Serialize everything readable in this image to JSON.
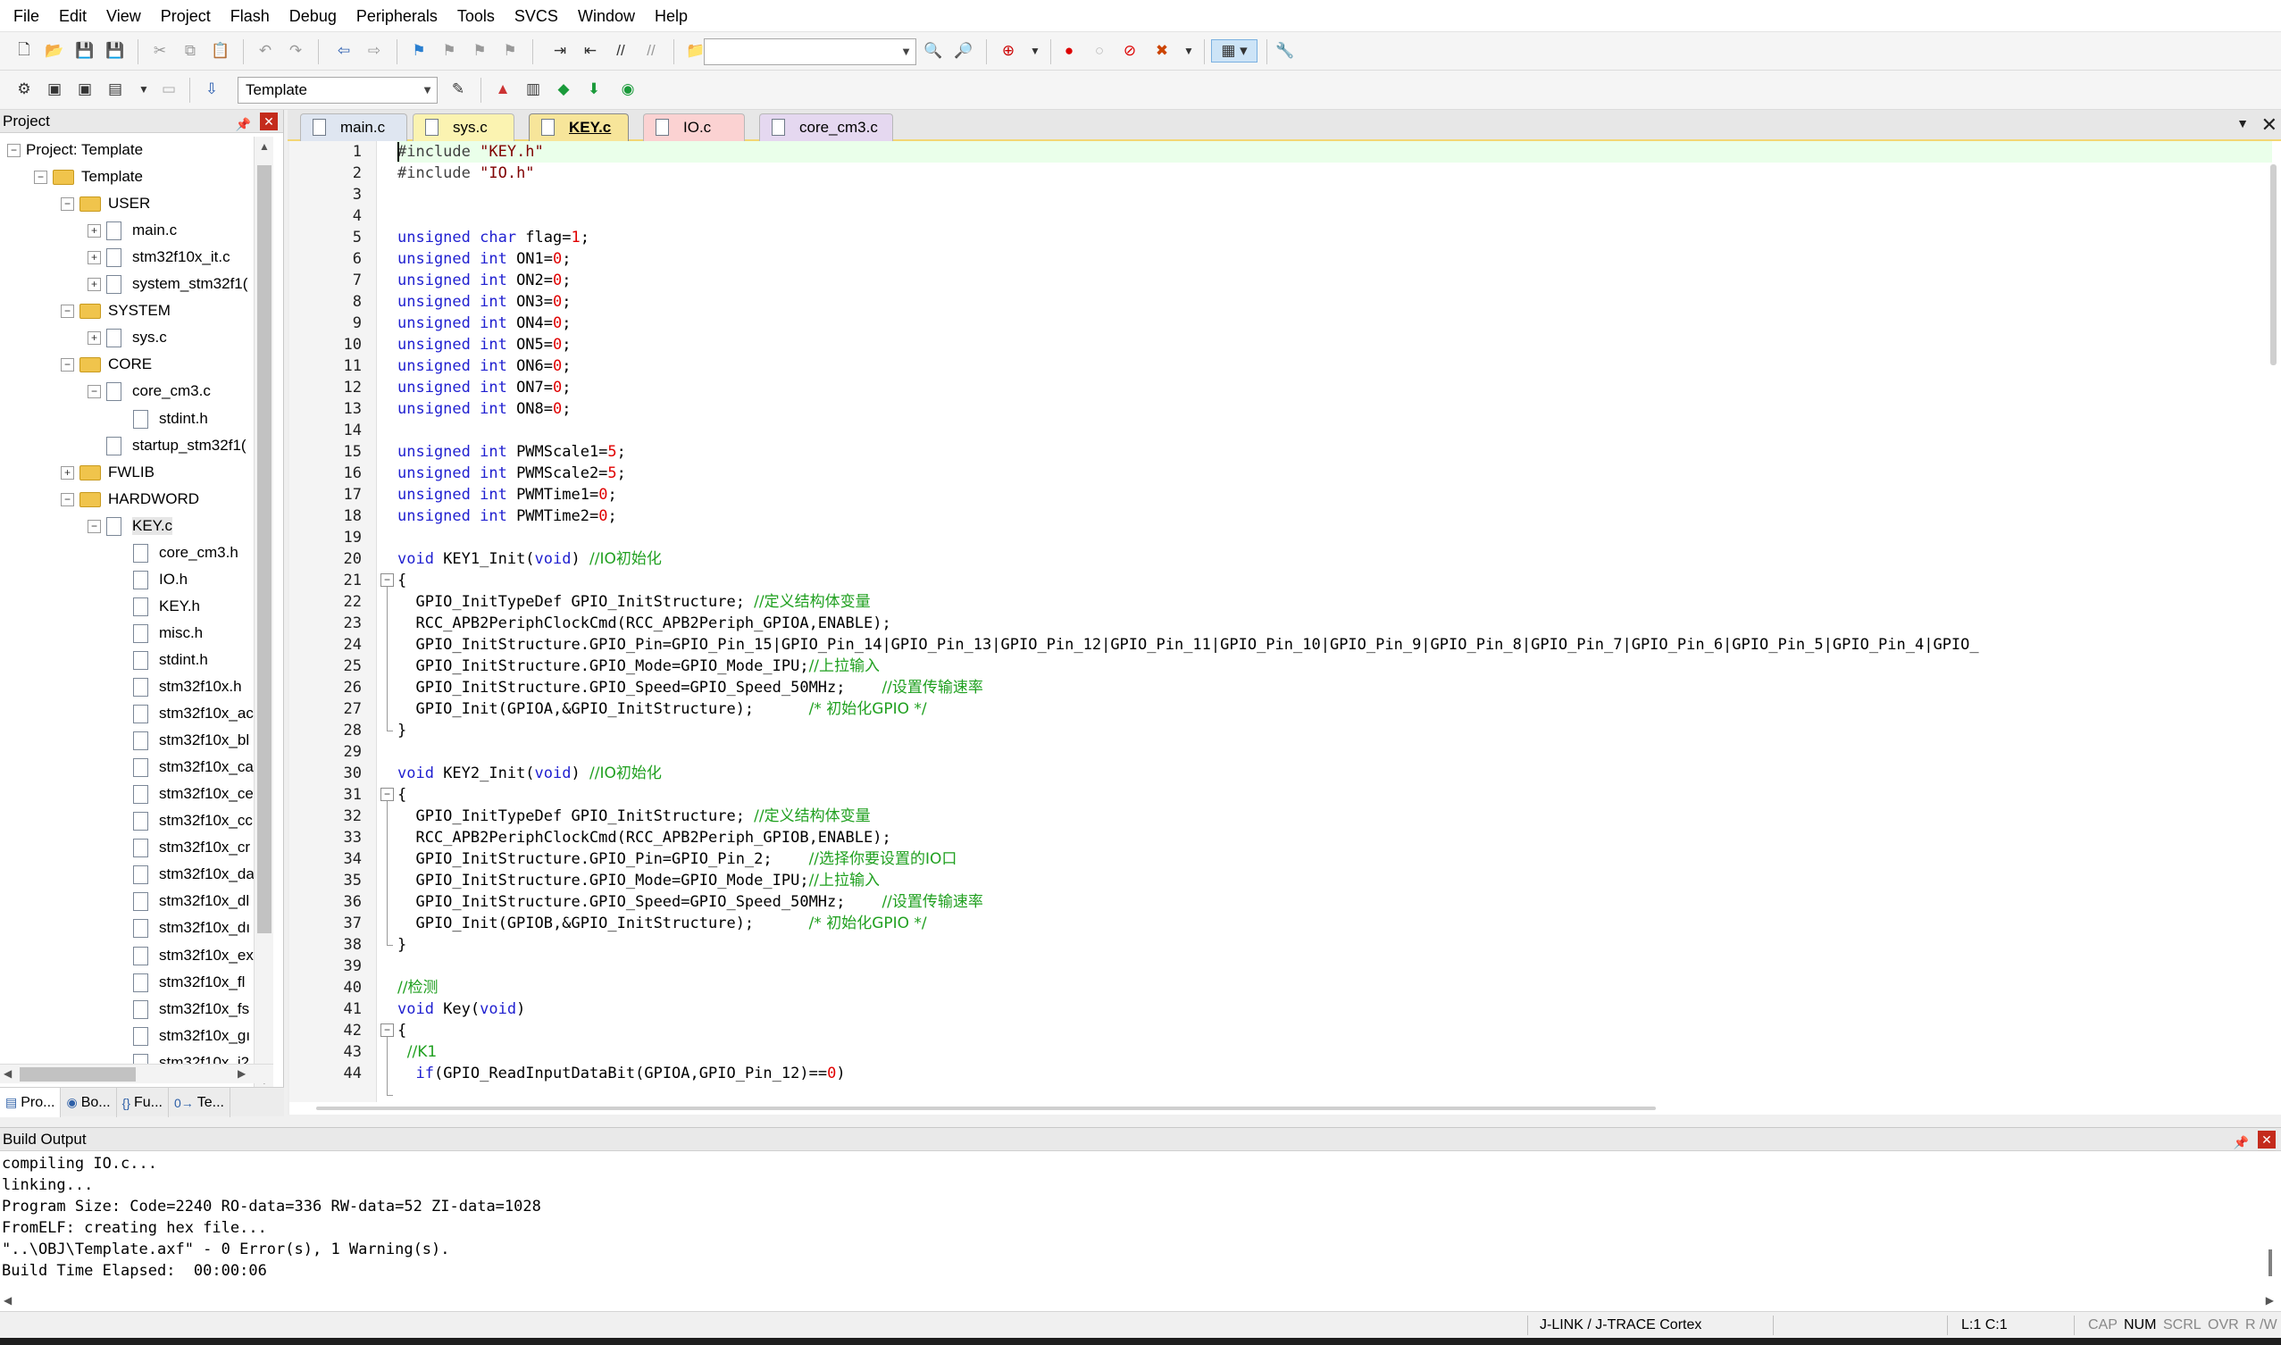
{
  "menu": [
    "File",
    "Edit",
    "View",
    "Project",
    "Flash",
    "Debug",
    "Peripherals",
    "Tools",
    "SVCS",
    "Window",
    "Help"
  ],
  "toolbar2": {
    "target_label": "Template"
  },
  "project_panel": {
    "title": "Project",
    "tree": [
      {
        "label": "Project: Template",
        "indent": 0,
        "expander": "-",
        "icon": "none"
      },
      {
        "label": "Template",
        "indent": 1,
        "expander": "-",
        "icon": "folder"
      },
      {
        "label": "USER",
        "indent": 2,
        "expander": "-",
        "icon": "folder"
      },
      {
        "label": "main.c",
        "indent": 3,
        "expander": "+",
        "icon": "file"
      },
      {
        "label": "stm32f10x_it.c",
        "indent": 3,
        "expander": "+",
        "icon": "file"
      },
      {
        "label": "system_stm32f1(",
        "indent": 3,
        "expander": "+",
        "icon": "file"
      },
      {
        "label": "SYSTEM",
        "indent": 2,
        "expander": "-",
        "icon": "folder"
      },
      {
        "label": "sys.c",
        "indent": 3,
        "expander": "+",
        "icon": "file"
      },
      {
        "label": "CORE",
        "indent": 2,
        "expander": "-",
        "icon": "folder"
      },
      {
        "label": "core_cm3.c",
        "indent": 3,
        "expander": "-",
        "icon": "file"
      },
      {
        "label": "stdint.h",
        "indent": 4,
        "expander": "",
        "icon": "file"
      },
      {
        "label": "startup_stm32f1(",
        "indent": 3,
        "expander": "",
        "icon": "file"
      },
      {
        "label": "FWLIB",
        "indent": 2,
        "expander": "+",
        "icon": "folder"
      },
      {
        "label": "HARDWORD",
        "indent": 2,
        "expander": "-",
        "icon": "folder"
      },
      {
        "label": "KEY.c",
        "indent": 3,
        "expander": "-",
        "icon": "file",
        "selected": true
      },
      {
        "label": "core_cm3.h",
        "indent": 4,
        "expander": "",
        "icon": "file"
      },
      {
        "label": "IO.h",
        "indent": 4,
        "expander": "",
        "icon": "file"
      },
      {
        "label": "KEY.h",
        "indent": 4,
        "expander": "",
        "icon": "file"
      },
      {
        "label": "misc.h",
        "indent": 4,
        "expander": "",
        "icon": "file"
      },
      {
        "label": "stdint.h",
        "indent": 4,
        "expander": "",
        "icon": "file"
      },
      {
        "label": "stm32f10x.h",
        "indent": 4,
        "expander": "",
        "icon": "file"
      },
      {
        "label": "stm32f10x_ac",
        "indent": 4,
        "expander": "",
        "icon": "file"
      },
      {
        "label": "stm32f10x_bl",
        "indent": 4,
        "expander": "",
        "icon": "file"
      },
      {
        "label": "stm32f10x_ca",
        "indent": 4,
        "expander": "",
        "icon": "file"
      },
      {
        "label": "stm32f10x_ce",
        "indent": 4,
        "expander": "",
        "icon": "file"
      },
      {
        "label": "stm32f10x_cc",
        "indent": 4,
        "expander": "",
        "icon": "file"
      },
      {
        "label": "stm32f10x_cr",
        "indent": 4,
        "expander": "",
        "icon": "file"
      },
      {
        "label": "stm32f10x_da",
        "indent": 4,
        "expander": "",
        "icon": "file"
      },
      {
        "label": "stm32f10x_dl",
        "indent": 4,
        "expander": "",
        "icon": "file"
      },
      {
        "label": "stm32f10x_dı",
        "indent": 4,
        "expander": "",
        "icon": "file"
      },
      {
        "label": "stm32f10x_ex",
        "indent": 4,
        "expander": "",
        "icon": "file"
      },
      {
        "label": "stm32f10x_fl",
        "indent": 4,
        "expander": "",
        "icon": "file"
      },
      {
        "label": "stm32f10x_fs",
        "indent": 4,
        "expander": "",
        "icon": "file"
      },
      {
        "label": "stm32f10x_gı",
        "indent": 4,
        "expander": "",
        "icon": "file"
      },
      {
        "label": "stm32f10x_i2",
        "indent": 4,
        "expander": "",
        "icon": "file"
      }
    ],
    "tabs": [
      {
        "label": "Pro...",
        "icon": "project-tab-icon",
        "glyph": "▤"
      },
      {
        "label": "Bo...",
        "icon": "books-tab-icon",
        "glyph": "◉"
      },
      {
        "label": "Fu...",
        "icon": "functions-tab-icon",
        "glyph": "{}"
      },
      {
        "label": "Te...",
        "icon": "templates-tab-icon",
        "glyph": "0→"
      }
    ]
  },
  "editor_tabs": [
    {
      "label": "main.c",
      "color": "#dfe6f1",
      "active": false
    },
    {
      "label": "sys.c",
      "color": "#fbf3b1",
      "active": false
    },
    {
      "label": "KEY.c",
      "color": "#f7e59a",
      "active": true
    },
    {
      "label": "IO.c",
      "color": "#fbd2d2",
      "active": false
    },
    {
      "label": "core_cm3.c",
      "color": "#e5d8f0",
      "active": false
    }
  ],
  "code_lines": [
    [
      [
        "pp",
        "#include "
      ],
      [
        "str",
        "\"KEY.h\""
      ]
    ],
    [
      [
        "pp",
        "#include "
      ],
      [
        "str",
        "\"IO.h\""
      ]
    ],
    [],
    [],
    [
      [
        "kw",
        "unsigned char "
      ],
      [
        "",
        "flag="
      ],
      [
        "num",
        "1"
      ],
      [
        "",
        ";"
      ]
    ],
    [
      [
        "kw",
        "unsigned int "
      ],
      [
        "",
        "ON1="
      ],
      [
        "num",
        "0"
      ],
      [
        "",
        ";"
      ]
    ],
    [
      [
        "kw",
        "unsigned int "
      ],
      [
        "",
        "ON2="
      ],
      [
        "num",
        "0"
      ],
      [
        "",
        ";"
      ]
    ],
    [
      [
        "kw",
        "unsigned int "
      ],
      [
        "",
        "ON3="
      ],
      [
        "num",
        "0"
      ],
      [
        "",
        ";"
      ]
    ],
    [
      [
        "kw",
        "unsigned int "
      ],
      [
        "",
        "ON4="
      ],
      [
        "num",
        "0"
      ],
      [
        "",
        ";"
      ]
    ],
    [
      [
        "kw",
        "unsigned int "
      ],
      [
        "",
        "ON5="
      ],
      [
        "num",
        "0"
      ],
      [
        "",
        ";"
      ]
    ],
    [
      [
        "kw",
        "unsigned int "
      ],
      [
        "",
        "ON6="
      ],
      [
        "num",
        "0"
      ],
      [
        "",
        ";"
      ]
    ],
    [
      [
        "kw",
        "unsigned int "
      ],
      [
        "",
        "ON7="
      ],
      [
        "num",
        "0"
      ],
      [
        "",
        ";"
      ]
    ],
    [
      [
        "kw",
        "unsigned int "
      ],
      [
        "",
        "ON8="
      ],
      [
        "num",
        "0"
      ],
      [
        "",
        ";"
      ]
    ],
    [],
    [
      [
        "kw",
        "unsigned int "
      ],
      [
        "",
        "PWMScale1="
      ],
      [
        "num",
        "5"
      ],
      [
        "",
        ";"
      ]
    ],
    [
      [
        "kw",
        "unsigned int "
      ],
      [
        "",
        "PWMScale2="
      ],
      [
        "num",
        "5"
      ],
      [
        "",
        ";"
      ]
    ],
    [
      [
        "kw",
        "unsigned int "
      ],
      [
        "",
        "PWMTime1="
      ],
      [
        "num",
        "0"
      ],
      [
        "",
        ";"
      ]
    ],
    [
      [
        "kw",
        "unsigned int "
      ],
      [
        "",
        "PWMTime2="
      ],
      [
        "num",
        "0"
      ],
      [
        "",
        ";"
      ]
    ],
    [],
    [
      [
        "kw",
        "void "
      ],
      [
        "",
        "KEY1_Init("
      ],
      [
        "kw",
        "void"
      ],
      [
        "",
        ") "
      ],
      [
        "cm",
        "//IO初始化"
      ]
    ],
    [
      [
        "",
        "{"
      ]
    ],
    [
      [
        "",
        "  GPIO_InitTypeDef GPIO_InitStructure; "
      ],
      [
        "cm",
        "//定义结构体变量"
      ]
    ],
    [
      [
        "",
        "  RCC_APB2PeriphClockCmd(RCC_APB2Periph_GPIOA,ENABLE);"
      ]
    ],
    [
      [
        "",
        "  GPIO_InitStructure.GPIO_Pin=GPIO_Pin_15|GPIO_Pin_14|GPIO_Pin_13|GPIO_Pin_12|GPIO_Pin_11|GPIO_Pin_10|GPIO_Pin_9|GPIO_Pin_8|GPIO_Pin_7|GPIO_Pin_6|GPIO_Pin_5|GPIO_Pin_4|GPIO_"
      ]
    ],
    [
      [
        "",
        "  GPIO_InitStructure.GPIO_Mode=GPIO_Mode_IPU;"
      ],
      [
        "cm",
        "//上拉输入"
      ]
    ],
    [
      [
        "",
        "  GPIO_InitStructure.GPIO_Speed=GPIO_Speed_50MHz;    "
      ],
      [
        "cm",
        "//设置传输速率"
      ]
    ],
    [
      [
        "",
        "  GPIO_Init(GPIOA,&GPIO_InitStructure);      "
      ],
      [
        "cm",
        "/* 初始化GPIO */"
      ]
    ],
    [
      [
        "",
        "}"
      ]
    ],
    [],
    [
      [
        "kw",
        "void "
      ],
      [
        "",
        "KEY2_Init("
      ],
      [
        "kw",
        "void"
      ],
      [
        "",
        ") "
      ],
      [
        "cm",
        "//IO初始化"
      ]
    ],
    [
      [
        "",
        "{"
      ]
    ],
    [
      [
        "",
        "  GPIO_InitTypeDef GPIO_InitStructure; "
      ],
      [
        "cm",
        "//定义结构体变量"
      ]
    ],
    [
      [
        "",
        "  RCC_APB2PeriphClockCmd(RCC_APB2Periph_GPIOB,ENABLE);"
      ]
    ],
    [
      [
        "",
        "  GPIO_InitStructure.GPIO_Pin=GPIO_Pin_2;    "
      ],
      [
        "cm",
        "//选择你要设置的IO口"
      ]
    ],
    [
      [
        "",
        "  GPIO_InitStructure.GPIO_Mode=GPIO_Mode_IPU;"
      ],
      [
        "cm",
        "//上拉输入"
      ]
    ],
    [
      [
        "",
        "  GPIO_InitStructure.GPIO_Speed=GPIO_Speed_50MHz;    "
      ],
      [
        "cm",
        "//设置传输速率"
      ]
    ],
    [
      [
        "",
        "  GPIO_Init(GPIOB,&GPIO_InitStructure);      "
      ],
      [
        "cm",
        "/* 初始化GPIO */"
      ]
    ],
    [
      [
        "",
        "}"
      ]
    ],
    [],
    [
      [
        "cm",
        "//检测"
      ]
    ],
    [
      [
        "kw",
        "void "
      ],
      [
        "",
        "Key("
      ],
      [
        "kw",
        "void"
      ],
      [
        "",
        ")"
      ]
    ],
    [
      [
        "",
        "{"
      ]
    ],
    [
      [
        "cm",
        "  //K1"
      ]
    ],
    [
      [
        "kw",
        "  if"
      ],
      [
        "",
        "(GPIO_ReadInputDataBit(GPIOA,GPIO_Pin_12)=="
      ],
      [
        "num",
        "0"
      ],
      [
        "",
        ")"
      ]
    ]
  ],
  "build_output": {
    "title": "Build Output",
    "lines": [
      "compiling IO.c...",
      "linking...",
      "Program Size: Code=2240 RO-data=336 RW-data=52 ZI-data=1028",
      "FromELF: creating hex file...",
      "\"..\\OBJ\\Template.axf\" - 0 Error(s), 1 Warning(s).",
      "Build Time Elapsed:  00:00:06"
    ]
  },
  "status": {
    "debugger": "J-LINK / J-TRACE Cortex",
    "cursor": "L:1 C:1",
    "cap": "CAP",
    "num": "NUM",
    "scrl": "SCRL",
    "ovr": "OVR",
    "rw": "R /W"
  }
}
